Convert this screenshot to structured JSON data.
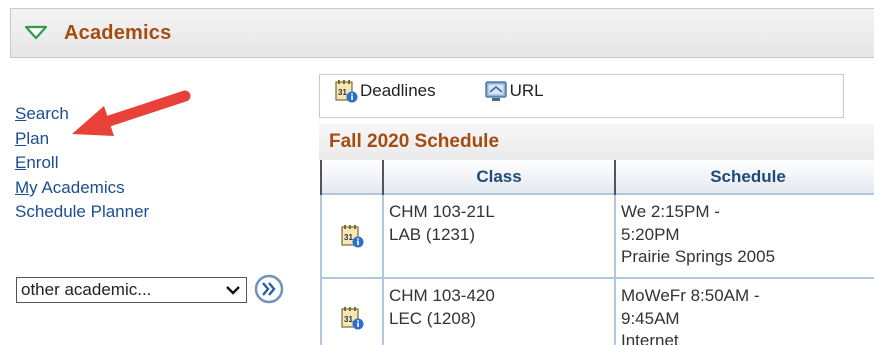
{
  "section": {
    "title": "Academics"
  },
  "nav": {
    "search": {
      "first": "S",
      "rest": "earch"
    },
    "plan": {
      "first": "P",
      "rest": "lan"
    },
    "enroll": {
      "first": "E",
      "rest": "nroll"
    },
    "my_academics": {
      "first": "M",
      "rest": "y Academics"
    },
    "schedule_planner": "Schedule Planner"
  },
  "other_select": {
    "value": "other academic..."
  },
  "quick_links": {
    "deadlines": "Deadlines",
    "url": "URL"
  },
  "schedule": {
    "title": "Fall 2020 Schedule",
    "columns": {
      "class": "Class",
      "schedule": "Schedule"
    },
    "rows": [
      {
        "class_line1": "CHM 103-21L",
        "class_line2": "LAB (1231)",
        "sched_line1": "We 2:15PM -",
        "sched_line2": "5:20PM",
        "sched_line3": "Prairie Springs 2005"
      },
      {
        "class_line1": "CHM 103-420",
        "class_line2": "LEC (1208)",
        "sched_line1": "MoWeFr 8:50AM -",
        "sched_line2": "9:45AM",
        "sched_line3": "Internet"
      }
    ]
  },
  "colors": {
    "accent": "#a44d11",
    "link": "#1a4f8f",
    "annotation": "#e8413a",
    "table_border": "#aec6de"
  }
}
